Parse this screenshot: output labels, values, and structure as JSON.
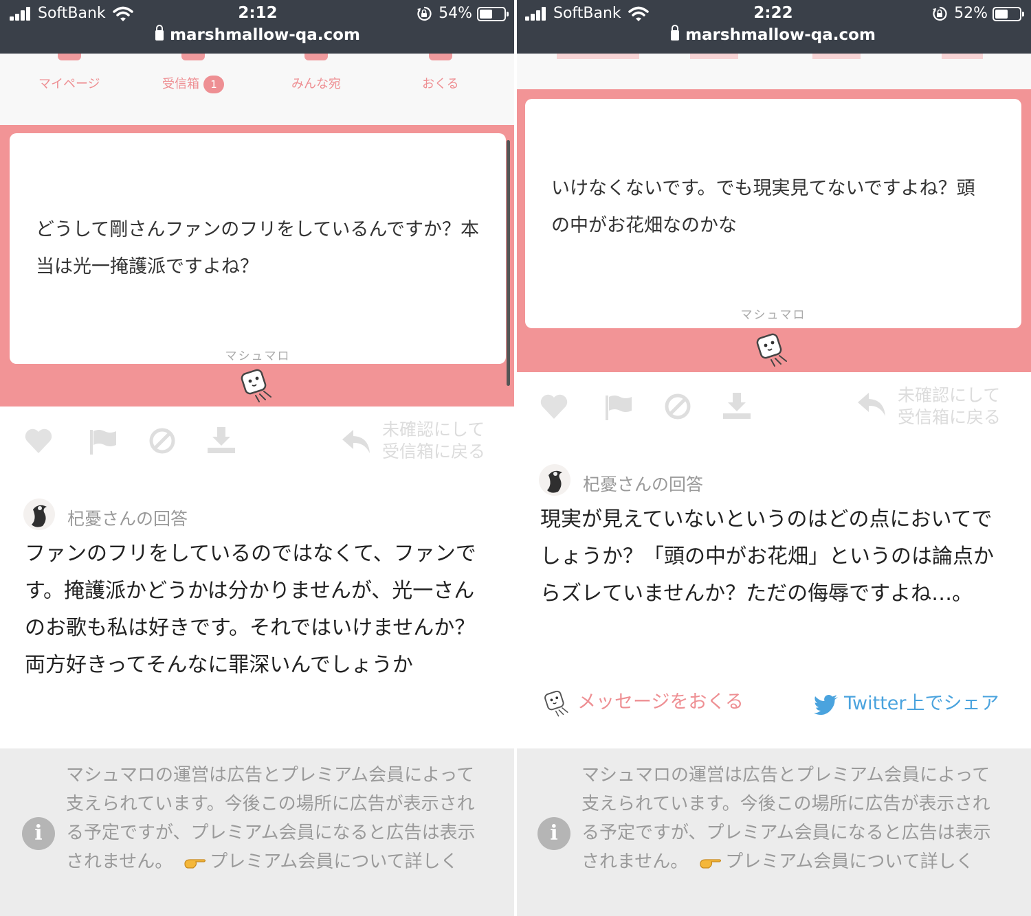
{
  "colors": {
    "brand_pink": "#f29496",
    "nav_pink": "#ee8f93",
    "twitter_blue": "#4aa3de",
    "status_bar": "#3a4049"
  },
  "icons": [
    "signal-icon",
    "wifi-icon",
    "orientation-lock-icon",
    "battery-icon",
    "lock-icon",
    "marshmallow-mascot-icon",
    "heart-icon",
    "flag-icon",
    "block-icon",
    "download-icon",
    "reply-arrow-icon",
    "twitter-bird-icon",
    "info-icon",
    "pointing-hand-icon"
  ],
  "left": {
    "status": {
      "carrier": "SoftBank",
      "time": "2:12",
      "battery": "54%",
      "battery_level": 0.54,
      "url": "marshmallow-qa.com"
    },
    "nav": {
      "mypage": "マイページ",
      "inbox": "受信箱",
      "inbox_badge": "1",
      "everyone": "みんな宛",
      "send": "おくる"
    },
    "card": {
      "question": "どうして剛さんファンのフリをしているんですか？本当は光一掩護派ですよね？",
      "brand": "マシュマロ"
    },
    "actions": {
      "back_line1": "未確認にして",
      "back_line2": "受信箱に戻る"
    },
    "answer": {
      "heading": "杞憂さんの回答",
      "body": "ファンのフリをしているのではなくて、ファンです。掩護派かどうかは分かりませんが、光一さんのお歌も私は好きです。それではいけませんか？両方好きってそんなに罪深いんでしょうか"
    },
    "notice": {
      "text": "マシュマロの運営は広告とプレミアム会員によって支えられています。今後この場所に広告が表示される予定ですが、プレミアム会員になると広告は表示されません。",
      "link": "プレミアム会員について詳しく"
    }
  },
  "right": {
    "status": {
      "carrier": "SoftBank",
      "time": "2:22",
      "battery": "52%",
      "battery_level": 0.52,
      "url": "marshmallow-qa.com"
    },
    "card": {
      "question": "いけなくないです。でも現実見てないですよね？頭の中がお花畑なのかな",
      "brand": "マシュマロ"
    },
    "actions": {
      "back_line1": "未確認にして",
      "back_line2": "受信箱に戻る"
    },
    "answer": {
      "heading": "杞憂さんの回答",
      "body": "現実が見えていないというのはどの点においてでしょうか？「頭の中がお花畑」というのは論点からズレていませんか？ただの侮辱ですよね…。",
      "send_message": "メッセージをおくる",
      "share_twitter": "Twitter上でシェア"
    },
    "notice": {
      "text": "マシュマロの運営は広告とプレミアム会員によって支えられています。今後この場所に広告が表示される予定ですが、プレミアム会員になると広告は表示されません。",
      "link": "プレミアム会員について詳しく"
    }
  }
}
